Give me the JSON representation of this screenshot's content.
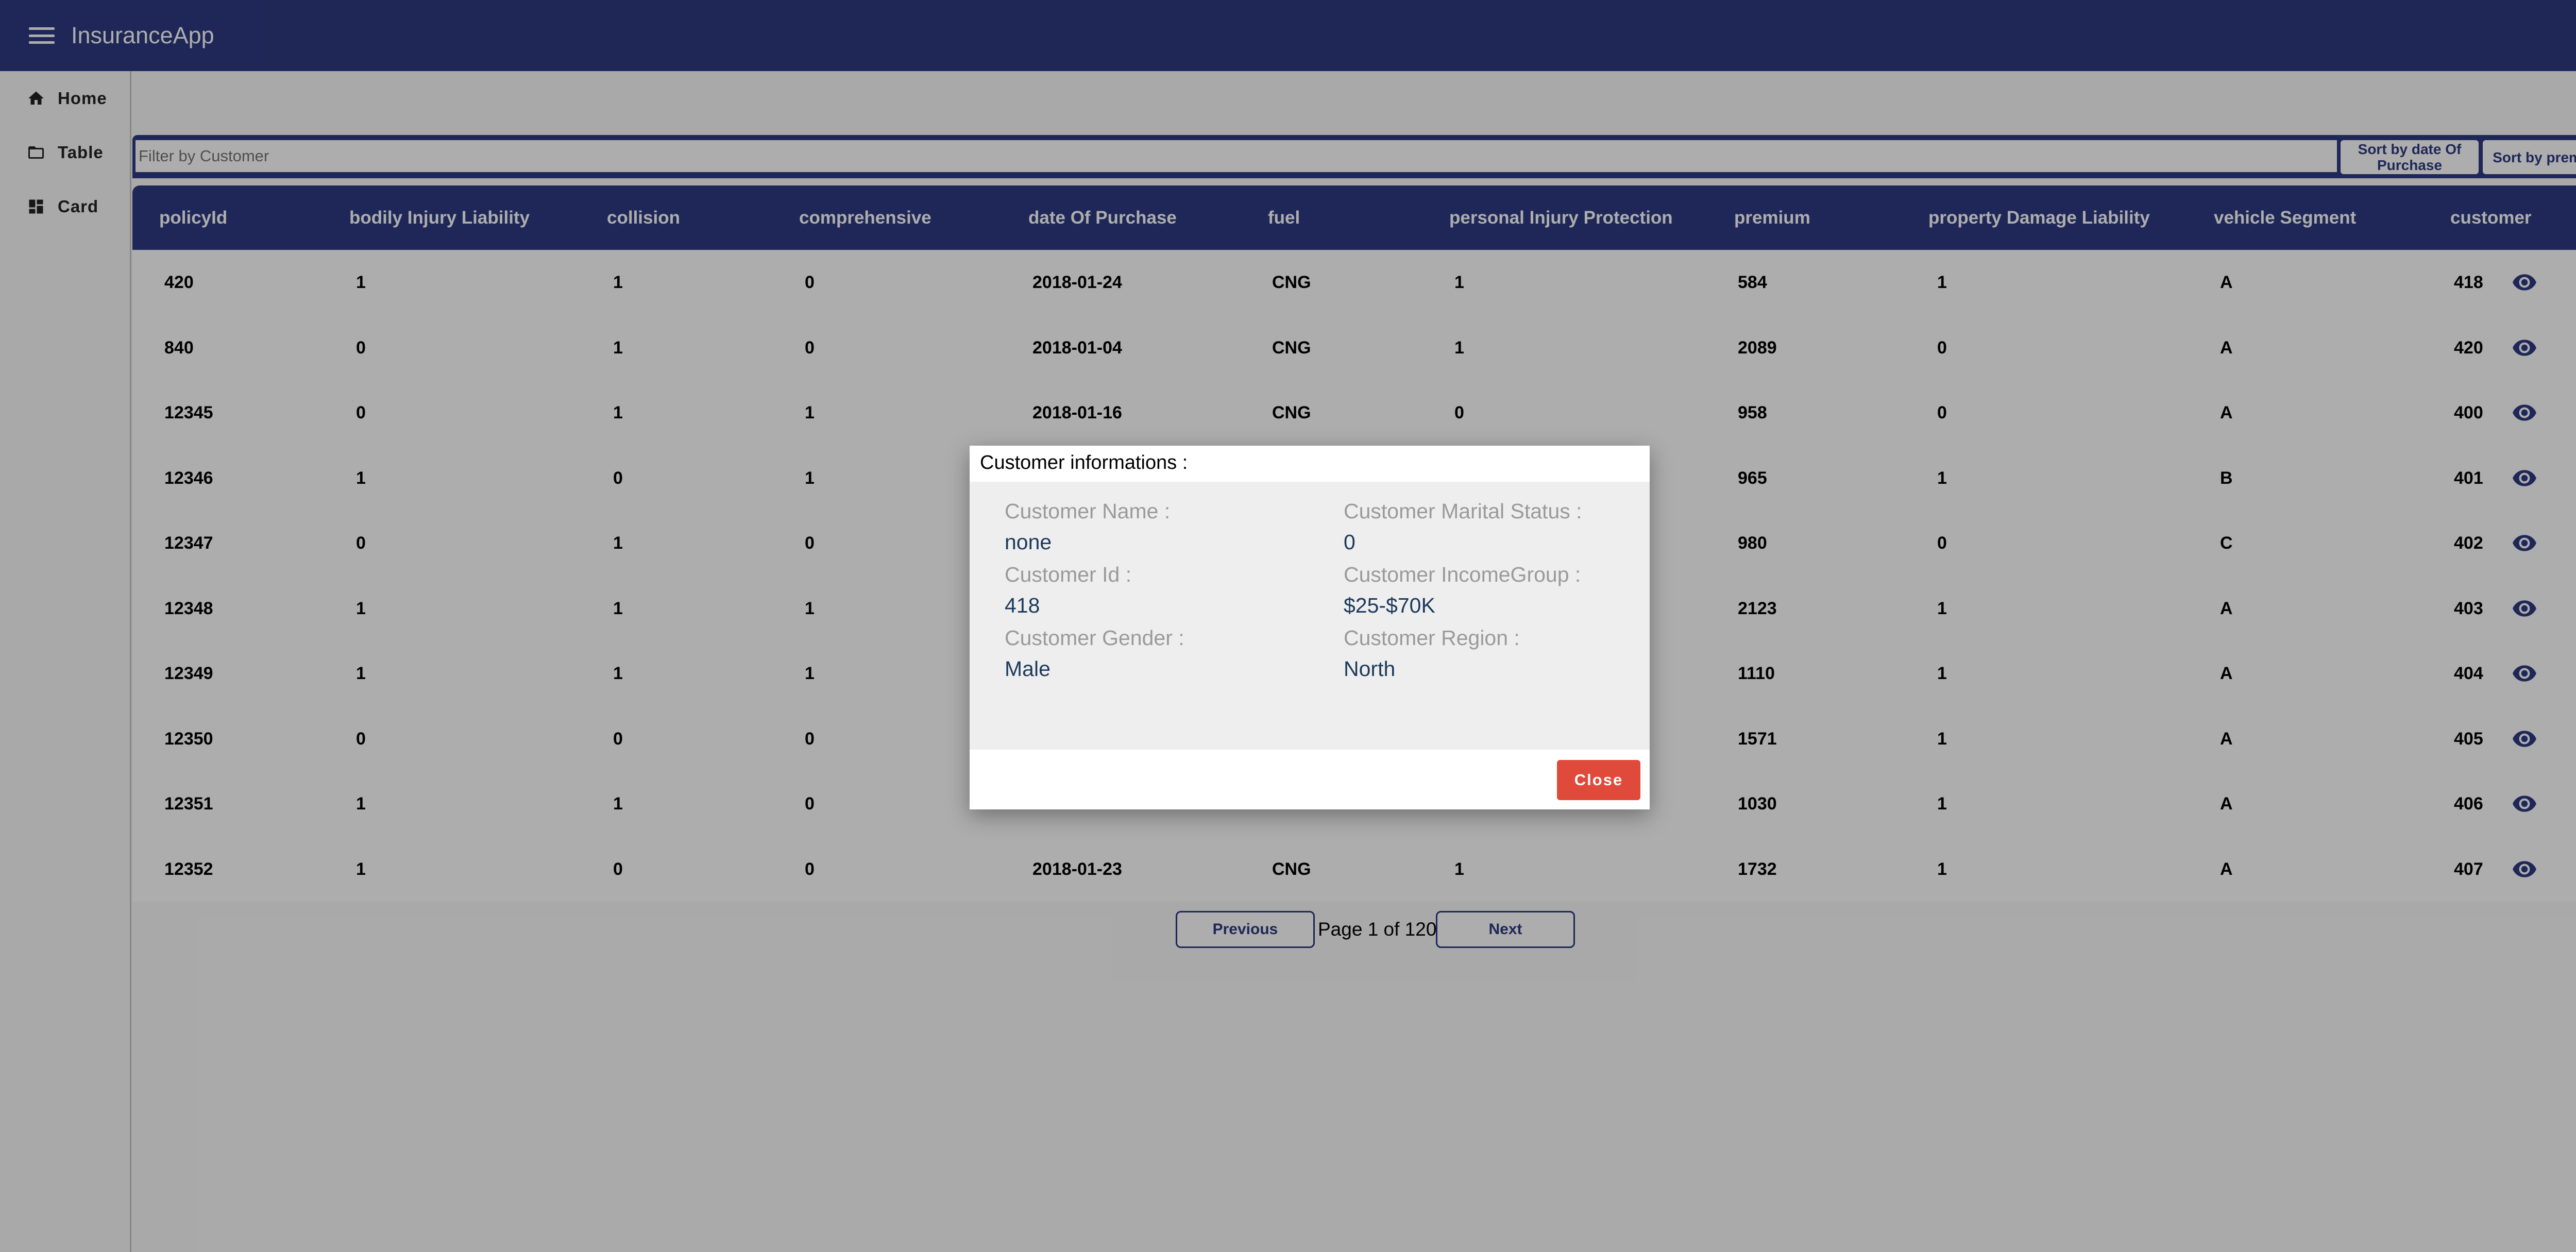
{
  "app": {
    "title": "InsuranceApp"
  },
  "sidebar": {
    "items": [
      {
        "label": "Home",
        "icon": "home-icon"
      },
      {
        "label": "Table",
        "icon": "folder-icon"
      },
      {
        "label": "Card",
        "icon": "dashboard-icon"
      }
    ]
  },
  "filter": {
    "placeholder": "Filter by Customer",
    "sort_date_label": "Sort by date Of Purchase",
    "sort_premium_label": "Sort by premium"
  },
  "table": {
    "columns": [
      "policyId",
      "bodily Injury Liability",
      "collision",
      "comprehensive",
      "date Of Purchase",
      "fuel",
      "personal Injury Protection",
      "premium",
      "property Damage Liability",
      "vehicle Segment",
      "customer"
    ],
    "rows": [
      [
        "420",
        "1",
        "1",
        "0",
        "2018-01-24",
        "CNG",
        "1",
        "584",
        "1",
        "A",
        "418"
      ],
      [
        "840",
        "0",
        "1",
        "0",
        "2018-01-04",
        "CNG",
        "1",
        "2089",
        "0",
        "A",
        "420"
      ],
      [
        "12345",
        "0",
        "1",
        "1",
        "2018-01-16",
        "CNG",
        "0",
        "958",
        "0",
        "A",
        "400"
      ],
      [
        "12346",
        "1",
        "0",
        "1",
        "",
        "",
        "",
        "965",
        "1",
        "B",
        "401"
      ],
      [
        "12347",
        "0",
        "1",
        "0",
        "",
        "",
        "",
        "980",
        "0",
        "C",
        "402"
      ],
      [
        "12348",
        "1",
        "1",
        "1",
        "",
        "",
        "",
        "2123",
        "1",
        "A",
        "403"
      ],
      [
        "12349",
        "1",
        "1",
        "1",
        "",
        "",
        "",
        "1110",
        "1",
        "A",
        "404"
      ],
      [
        "12350",
        "0",
        "0",
        "0",
        "",
        "",
        "",
        "1571",
        "1",
        "A",
        "405"
      ],
      [
        "12351",
        "1",
        "1",
        "0",
        "",
        "",
        "",
        "1030",
        "1",
        "A",
        "406"
      ],
      [
        "12352",
        "1",
        "0",
        "0",
        "2018-01-23",
        "CNG",
        "1",
        "1732",
        "1",
        "A",
        "407"
      ]
    ]
  },
  "pagination": {
    "previous_label": "Previous",
    "page_text": "Page 1 of 120",
    "next_label": "Next"
  },
  "dialog": {
    "title": "Customer informations :",
    "fields": [
      {
        "label": "Customer Name :",
        "value": "none"
      },
      {
        "label": "Customer Marital Status :",
        "value": "0"
      },
      {
        "label": "Customer Id :",
        "value": "418"
      },
      {
        "label": "Customer IncomeGroup :",
        "value": "$25-$70K"
      },
      {
        "label": "Customer Gender :",
        "value": "Male"
      },
      {
        "label": "Customer Region :",
        "value": "North"
      }
    ],
    "close_label": "Close"
  },
  "colors": {
    "primary": "#2d3a80",
    "danger": "#e04a3b",
    "dialog_value": "#1b3a5c"
  }
}
